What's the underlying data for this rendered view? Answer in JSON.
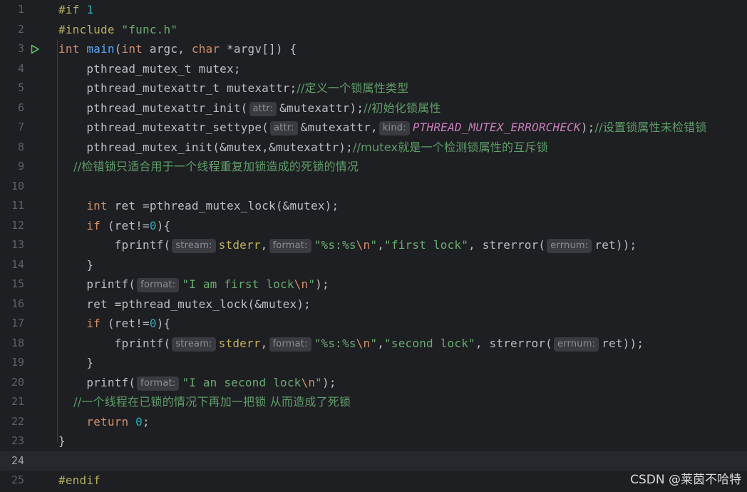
{
  "editor": {
    "line_numbers": [
      "1",
      "2",
      "3",
      "4",
      "5",
      "6",
      "7",
      "8",
      "9",
      "10",
      "11",
      "12",
      "13",
      "14",
      "15",
      "16",
      "17",
      "18",
      "19",
      "20",
      "21",
      "22",
      "23",
      "24",
      "25"
    ],
    "current_line": "24",
    "lines": {
      "l1_kw": "#if",
      "l1_num": "1",
      "l2_kw": "#include",
      "l2_str": "\"func.h\"",
      "l3_t1": "int",
      "l3_fn": "main",
      "l3_p1": "(",
      "l3_t2": "int",
      "l3_p2": " argc, ",
      "l3_t3": "char",
      "l3_p3": " *argv[]) {",
      "l4": "    pthread_mutex_t mutex;",
      "l5_code": "    pthread_mutexattr_t mutexattr;",
      "l5_cm": "//定义一个锁属性类型",
      "l6_a": "    pthread_mutexattr_init(",
      "l6_hint": "attr:",
      "l6_b": "&mutexattr);",
      "l6_cm": "//初始化锁属性",
      "l7_a": "    pthread_mutexattr_settype(",
      "l7_hint1": "attr:",
      "l7_b": "&mutexattr,",
      "l7_hint2": "kind:",
      "l7_macro": "PTHREAD_MUTEX_ERRORCHECK",
      "l7_c": ");",
      "l7_cm": "//设置锁属性未检错锁",
      "l8_code": "    pthread_mutex_init(&mutex,&mutexattr);",
      "l8_cm": "//mutex就是一个检测锁属性的互斥锁",
      "l9_cm": "    //检错锁只适合用于一个线程重复加锁造成的死锁的情况",
      "l11_kw": "    int",
      "l11_rest": " ret =pthread_mutex_lock(&mutex);",
      "l12_kw": "    if",
      "l12_a": " (ret!=",
      "l12_num": "0",
      "l12_b": "){",
      "l13_a": "        fprintf(",
      "l13_hint1": "stream:",
      "l13_glob": "stderr",
      "l13_b": ",",
      "l13_hint2": "format:",
      "l13_str1": "\"%s:%s",
      "l13_esc": "\\n",
      "l13_str1e": "\"",
      "l13_c": ",",
      "l13_str2": "\"first lock\"",
      "l13_d": ", strerror(",
      "l13_hint3": "errnum:",
      "l13_e": "ret));",
      "l14": "    }",
      "l15_a": "    printf(",
      "l15_hint": "format:",
      "l15_str": "\"I am first lock",
      "l15_esc": "\\n",
      "l15_stre": "\"",
      "l15_b": ");",
      "l16": "    ret =pthread_mutex_lock(&mutex);",
      "l17_kw": "    if",
      "l17_a": " (ret!=",
      "l17_num": "0",
      "l17_b": "){",
      "l18_a": "        fprintf(",
      "l18_hint1": "stream:",
      "l18_glob": "stderr",
      "l18_b": ",",
      "l18_hint2": "format:",
      "l18_str1": "\"%s:%s",
      "l18_esc": "\\n",
      "l18_str1e": "\"",
      "l18_c": ",",
      "l18_str2": "\"second lock\"",
      "l18_d": ", strerror(",
      "l18_hint3": "errnum:",
      "l18_e": "ret));",
      "l19": "    }",
      "l20_a": "    printf(",
      "l20_hint": "format:",
      "l20_str": "\"I an second lock",
      "l20_esc": "\\n",
      "l20_stre": "\"",
      "l20_b": ");",
      "l21_cm": "    //一个线程在已锁的情况下再加一把锁 从而造成了死锁",
      "l22_kw": "    return",
      "l22_num": " 0",
      "l22_b": ";",
      "l23": "}",
      "l25_kw": "#endif"
    }
  },
  "watermark": "CSDN @莱茵不哈特",
  "colors": {
    "background": "#1e1f22",
    "keyword": "#cf8e6d",
    "string": "#6aab73",
    "number": "#2aacb8",
    "comment": "#5f9e6a",
    "macro": "#c77dbb",
    "run_icon": "#5fb865"
  },
  "icons": {
    "run": "run-gutter-icon"
  }
}
